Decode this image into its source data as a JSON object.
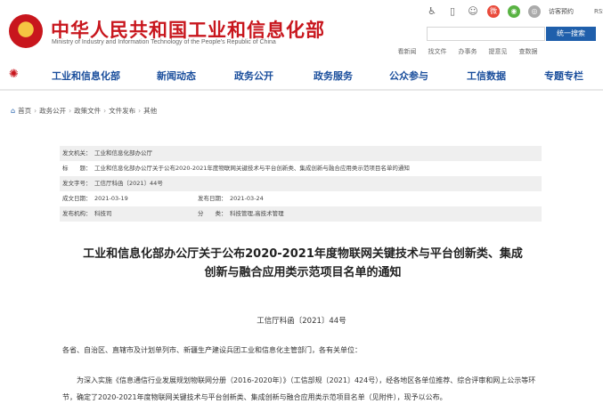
{
  "header": {
    "title": "中华人民共和国工业和信息化部",
    "subtitle": "Ministry of Industry and Information Technology of the People's Republic of China",
    "top_links": {
      "visit": "访客预约",
      "rss": "RSS订阅"
    },
    "search": {
      "placeholder": "",
      "button": "统一搜索"
    },
    "quick_links": [
      "看新闻",
      "找文件",
      "办事务",
      "提意见",
      "查数据"
    ]
  },
  "nav": {
    "items": [
      "工业和信息化部",
      "新闻动态",
      "政务公开",
      "政务服务",
      "公众参与",
      "工信数据",
      "专题专栏"
    ]
  },
  "breadcrumb": [
    "首页",
    "政务公开",
    "政策文件",
    "文件发布",
    "其他"
  ],
  "info_table": {
    "issuer_label": "发文机关：",
    "issuer": "工业和信息化部办公厅",
    "title_label": "标　　题：",
    "title": "工业和信息化部办公厅关于公布2020-2021年度物联网关键技术与平台创新类、集成创新与融合应用类示范项目名单的通知",
    "number_label": "发文字号：",
    "number": "工信厅科函〔2021〕44号",
    "written_label": "成文日期：",
    "written": "2021-03-19",
    "published_label": "发布日期：",
    "published": "2021-03-24",
    "org_label": "发布机构：",
    "org": "科技司",
    "category_label": "分　　类：",
    "category": "科技管理,高技术管理"
  },
  "document": {
    "title_line1": "工业和信息化部办公厅关于公布2020-2021年度物联网关键技术与平台创新类、集成",
    "title_line2": "创新与融合应用类示范项目名单的通知",
    "doc_number": "工信厅科函〔2021〕44号",
    "addressee": "各省、自治区、直辖市及计划单列市、新疆生产建设兵团工业和信息化主管部门，各有关单位：",
    "paragraph": "为深入实施《信息通信行业发展规划物联网分册（2016-2020年）》（工信部规〔2021〕424号），经各地区各单位推荐、综合评审和网上公示等环节，确定了2020-2021年度物联网关键技术与平台创新类、集成创新与融合应用类示范项目名单（见附件），现予以公布。"
  }
}
